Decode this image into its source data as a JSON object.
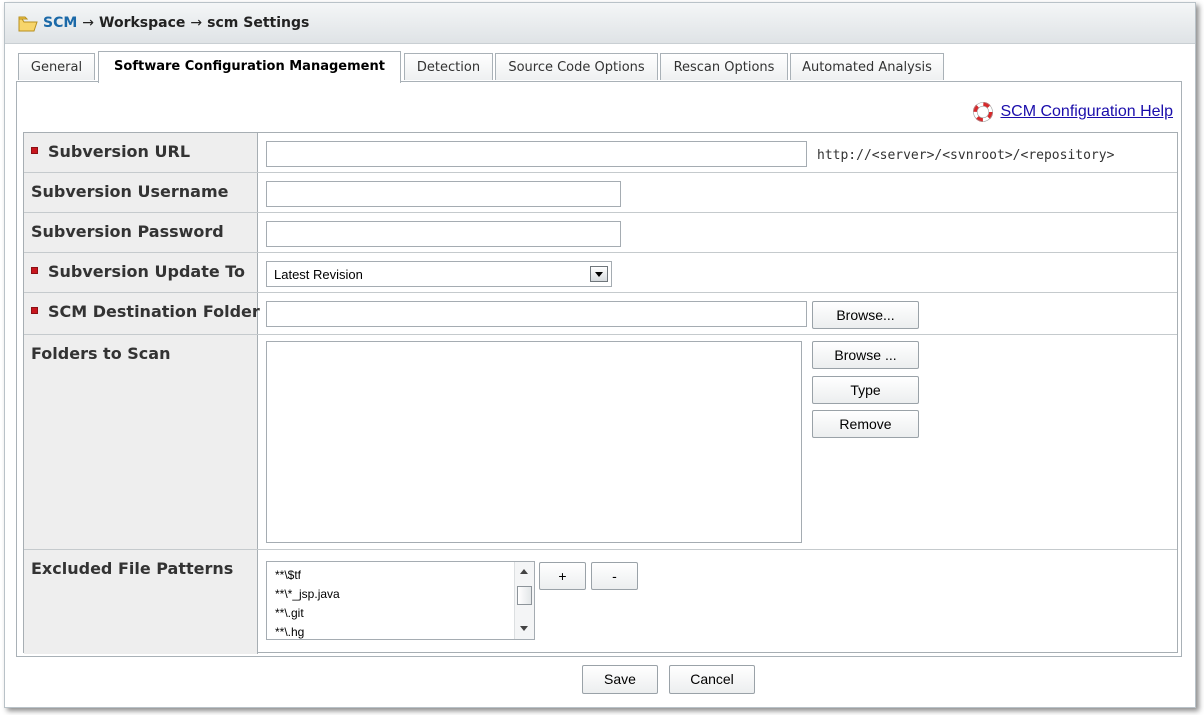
{
  "breadcrumb": {
    "root": "SCM",
    "sep1": "→",
    "middle": "Workspace",
    "sep2": "→",
    "current": "scm Settings"
  },
  "tabs": [
    {
      "label": "General"
    },
    {
      "label": "Software Configuration Management",
      "active": true
    },
    {
      "label": "Detection"
    },
    {
      "label": "Source Code Options"
    },
    {
      "label": "Rescan Options"
    },
    {
      "label": "Automated Analysis"
    }
  ],
  "help": {
    "label": "SCM Configuration Help",
    "icon": "lifebuoy-icon"
  },
  "form": {
    "svn_url": {
      "label": "Subversion URL",
      "required": true,
      "value": "",
      "hint": "http://<server>/<svnroot>/<repository>"
    },
    "svn_username": {
      "label": "Subversion Username",
      "value": ""
    },
    "svn_password": {
      "label": "Subversion Password",
      "value": ""
    },
    "svn_update_to": {
      "label": "Subversion Update To",
      "required": true,
      "value": "Latest Revision"
    },
    "dest_folder": {
      "label": "SCM Destination Folder",
      "required": true,
      "value": "",
      "browse_label": "Browse..."
    },
    "folders_to_scan": {
      "label": "Folders to Scan",
      "browse_label": "Browse ...",
      "type_label": "Type",
      "remove_label": "Remove"
    },
    "excluded": {
      "label": "Excluded File Patterns",
      "patterns": [
        "**\\$tf",
        "**\\*_jsp.java",
        "**\\.git",
        "**\\.hg"
      ],
      "add_label": "+",
      "remove_label": "-"
    }
  },
  "footer": {
    "save_label": "Save",
    "cancel_label": "Cancel"
  },
  "colors": {
    "required_marker": "#c8161e",
    "link": "#1a0dab",
    "breadcrumb_link": "#1b69a8"
  }
}
